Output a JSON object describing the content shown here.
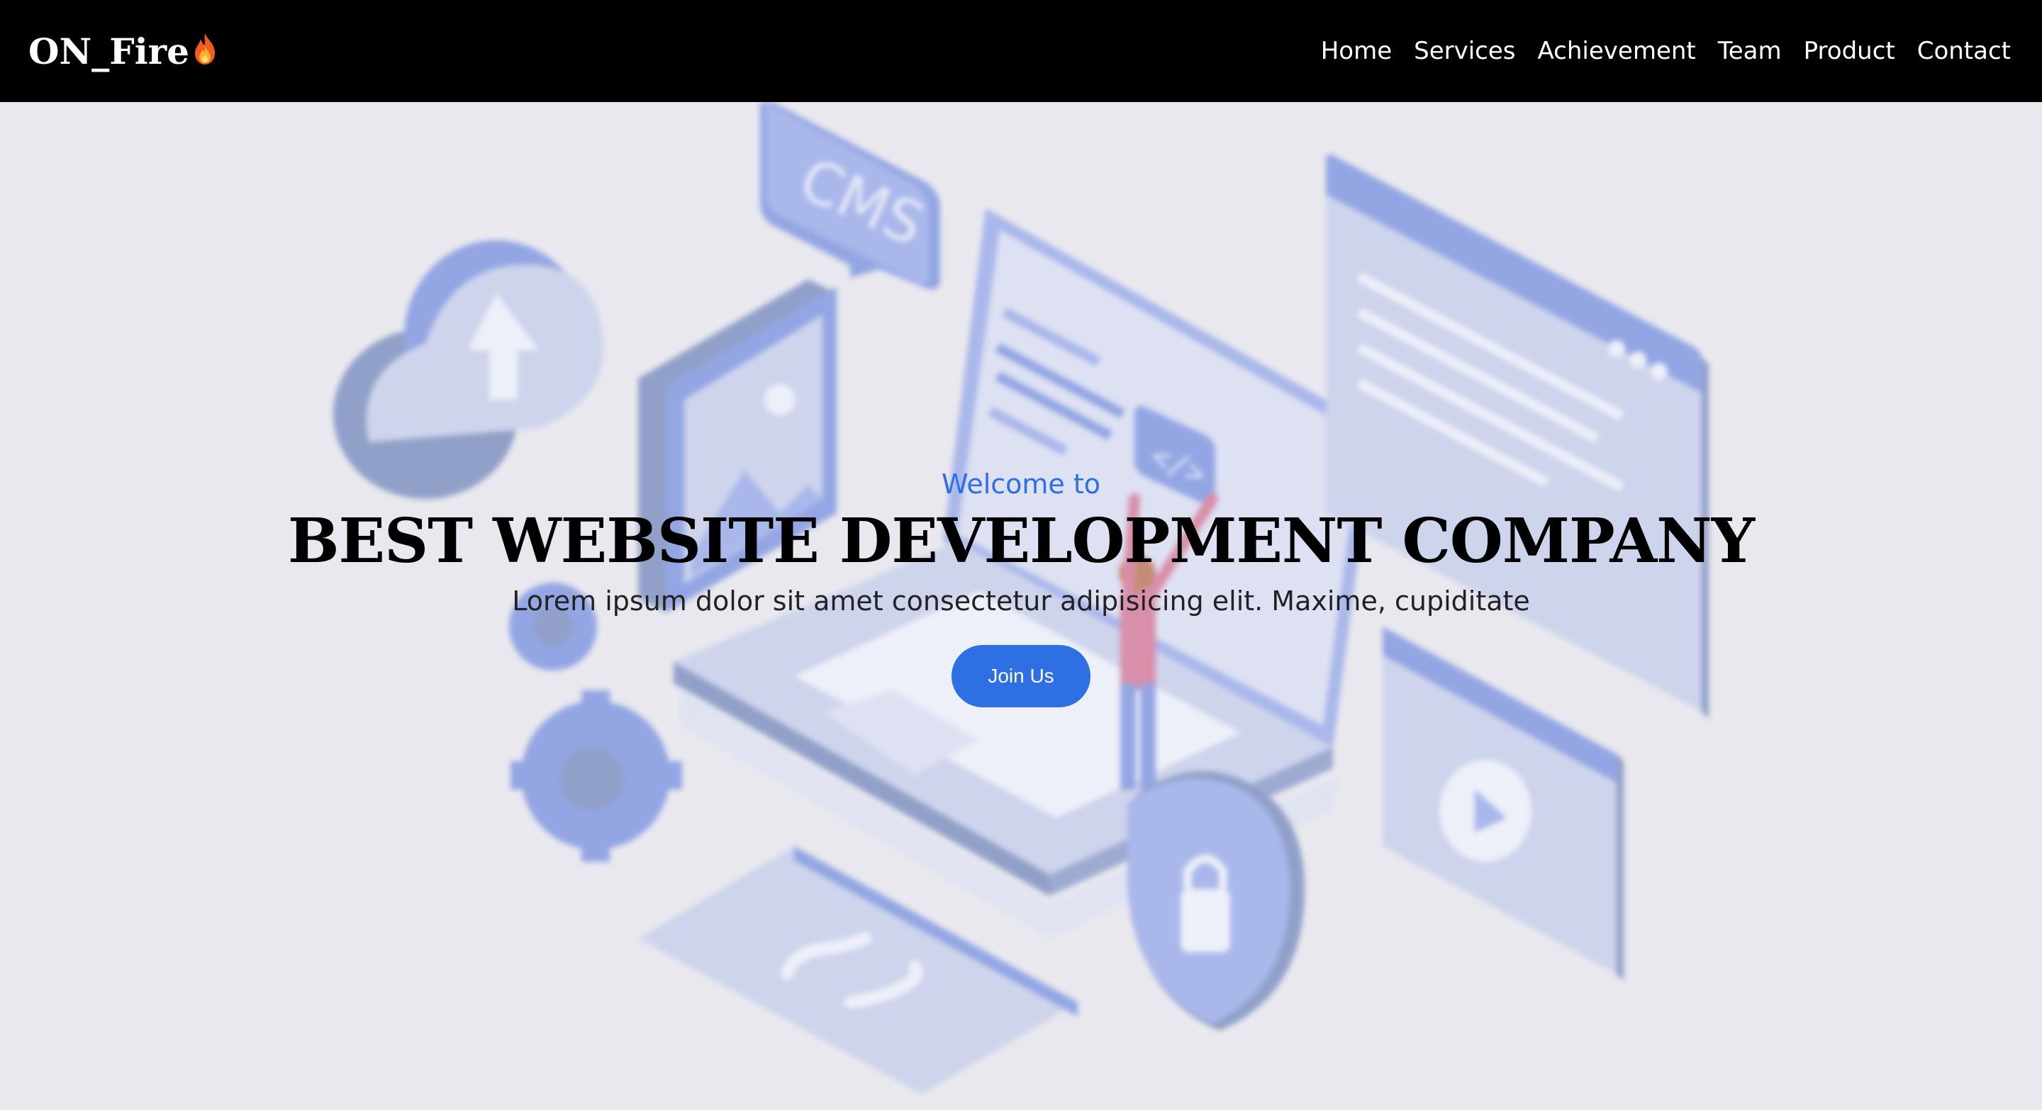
{
  "brand": {
    "name": "ON_Fire",
    "icon": "fire-icon"
  },
  "nav": {
    "items": [
      {
        "label": "Home"
      },
      {
        "label": "Services"
      },
      {
        "label": "Achievement"
      },
      {
        "label": "Team"
      },
      {
        "label": "Product"
      },
      {
        "label": "Contact"
      }
    ]
  },
  "hero": {
    "welcome": "Welcome to",
    "title": "BEST WEBSITE DEVELOPMENT COMPANY",
    "subtitle": "Lorem ipsum dolor sit amet consectetur adipisicing elit. Maxime, cupiditate",
    "cta_label": "Join Us",
    "illustration_text": {
      "cms": "CMS",
      "code": "</>"
    }
  },
  "colors": {
    "nav_background": "#000000",
    "accent": "#2f6fe4",
    "hero_background": "#e8e8ee"
  }
}
